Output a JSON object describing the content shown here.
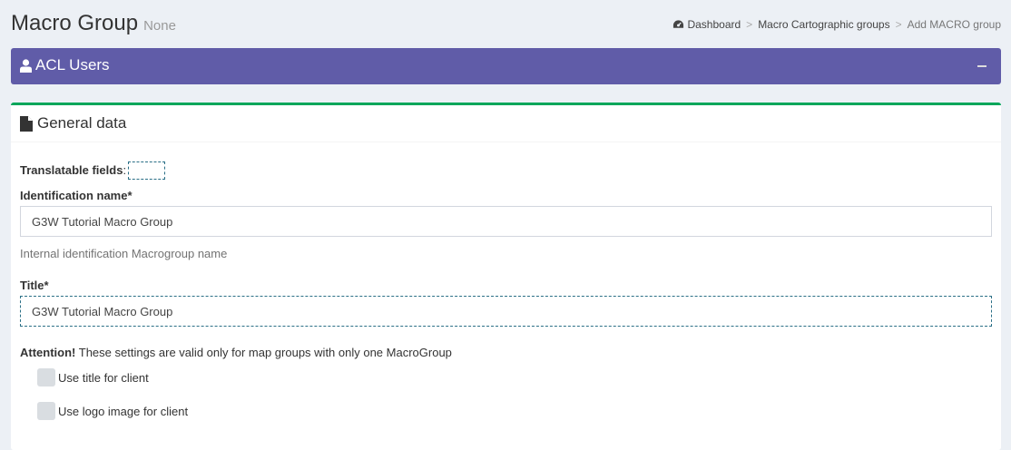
{
  "header": {
    "title": "Macro Group",
    "subtitle": "None"
  },
  "breadcrumb": {
    "items": [
      "Dashboard",
      "Macro Cartographic groups",
      "Add MACRO group"
    ]
  },
  "acl_box": {
    "title": "ACL Users",
    "icon": "user-icon",
    "color": "#605ca8"
  },
  "general_box": {
    "title": "General data",
    "icon": "file-icon",
    "accent": "#00a65a"
  },
  "form": {
    "translatable_label": "Translatable fields",
    "translatable_colon": ":",
    "identification_label": "Identification name*",
    "identification_value": "G3W Tutorial Macro Group",
    "identification_help": "Internal identification Macrogroup name",
    "title_label": "Title*",
    "title_value": "G3W Tutorial Macro Group",
    "attention_strong": "Attention!",
    "attention_text": " These settings are valid only for map groups with only one MacroGroup",
    "use_title_label": "Use title for client",
    "use_logo_label": "Use logo image for client"
  }
}
